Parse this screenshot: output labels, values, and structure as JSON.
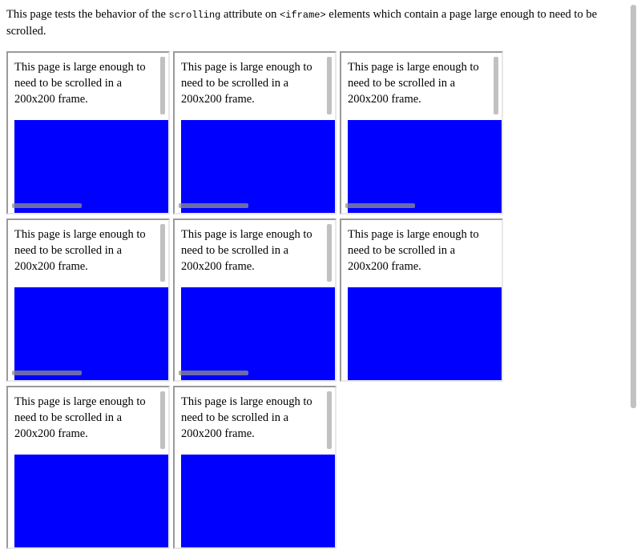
{
  "intro": {
    "before": "This page tests the behavior of the ",
    "attr_code": "scrolling",
    "middle": " attribute on ",
    "tag_code": "<iframe>",
    "after": " elements which contain a page large enough to need to be scrolled."
  },
  "frames": [
    {
      "text": "This page is large enough to need to be scrolled in a 200x200 frame.",
      "vertical_scrollbar": true,
      "horizontal_scrollbar": true
    },
    {
      "text": "This page is large enough to need to be scrolled in a 200x200 frame.",
      "vertical_scrollbar": true,
      "horizontal_scrollbar": true
    },
    {
      "text": "This page is large enough to need to be scrolled in a 200x200 frame.",
      "vertical_scrollbar": true,
      "horizontal_scrollbar": true
    },
    {
      "text": "This page is large enough to need to be scrolled in a 200x200 frame.",
      "vertical_scrollbar": true,
      "horizontal_scrollbar": true
    },
    {
      "text": "This page is large enough to need to be scrolled in a 200x200 frame.",
      "vertical_scrollbar": true,
      "horizontal_scrollbar": true
    },
    {
      "text": "This page is large enough to need to be scrolled in a 200x200 frame.",
      "vertical_scrollbar": false,
      "horizontal_scrollbar": false
    },
    {
      "text": "This page is large enough to need to be scrolled in a 200x200 frame.",
      "vertical_scrollbar": true,
      "horizontal_scrollbar": false
    },
    {
      "text": "This page is large enough to need to be scrolled in a 200x200 frame.",
      "vertical_scrollbar": true,
      "horizontal_scrollbar": false
    }
  ],
  "colors": {
    "block": "#0000ff",
    "scrollbar": "#c1c1c1"
  }
}
